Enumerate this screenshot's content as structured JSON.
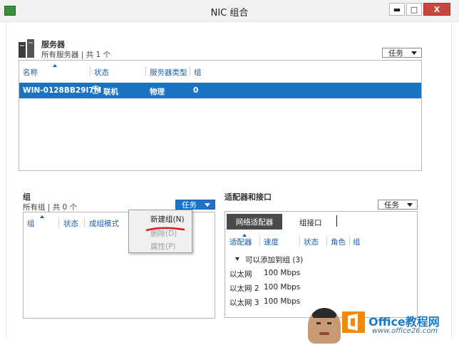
{
  "window": {
    "title": "NIC 组合",
    "min": "▬",
    "max": "□",
    "close": "X"
  },
  "servers": {
    "heading": "服务器",
    "subtitle": "所有服务器 | 共 1 个",
    "task_label": "任务",
    "columns": [
      "名称",
      "状态",
      "服务器类型",
      "组"
    ],
    "rows": [
      {
        "name": "WIN-0128BB29I7M",
        "status": "联机",
        "type": "物理",
        "group": "0"
      }
    ]
  },
  "groups": {
    "heading": "组",
    "subtitle": "所有组 | 共 0 个",
    "task_label": "任务",
    "columns": [
      "组",
      "状态",
      "成组模式"
    ]
  },
  "context_menu": {
    "items": [
      {
        "label": "新建组(N)",
        "enabled": true
      },
      {
        "label": "删除(D)",
        "enabled": false
      },
      {
        "label": "属性(P)",
        "enabled": false
      }
    ]
  },
  "adapters": {
    "heading": "适配器和接口",
    "task_label": "任务",
    "tabs": [
      "网络适配器",
      "组接口"
    ],
    "columns": [
      "适配器",
      "速度",
      "状态",
      "角色",
      "组"
    ],
    "group_label": "可以添加到组 (3)",
    "rows": [
      {
        "name": "以太网",
        "speed": "100 Mbps"
      },
      {
        "name": "以太网 2",
        "speed": "100 Mbps"
      },
      {
        "name": "以太网 3",
        "speed": "100 Mbps"
      }
    ]
  },
  "watermark": {
    "brand": "Office教程网",
    "url": "www.office26.com"
  },
  "colors": {
    "selection": "#1a73c3",
    "task_blue": "#1e73c8",
    "close_red": "#c8463d",
    "logo_orange": "#f28a0a"
  }
}
